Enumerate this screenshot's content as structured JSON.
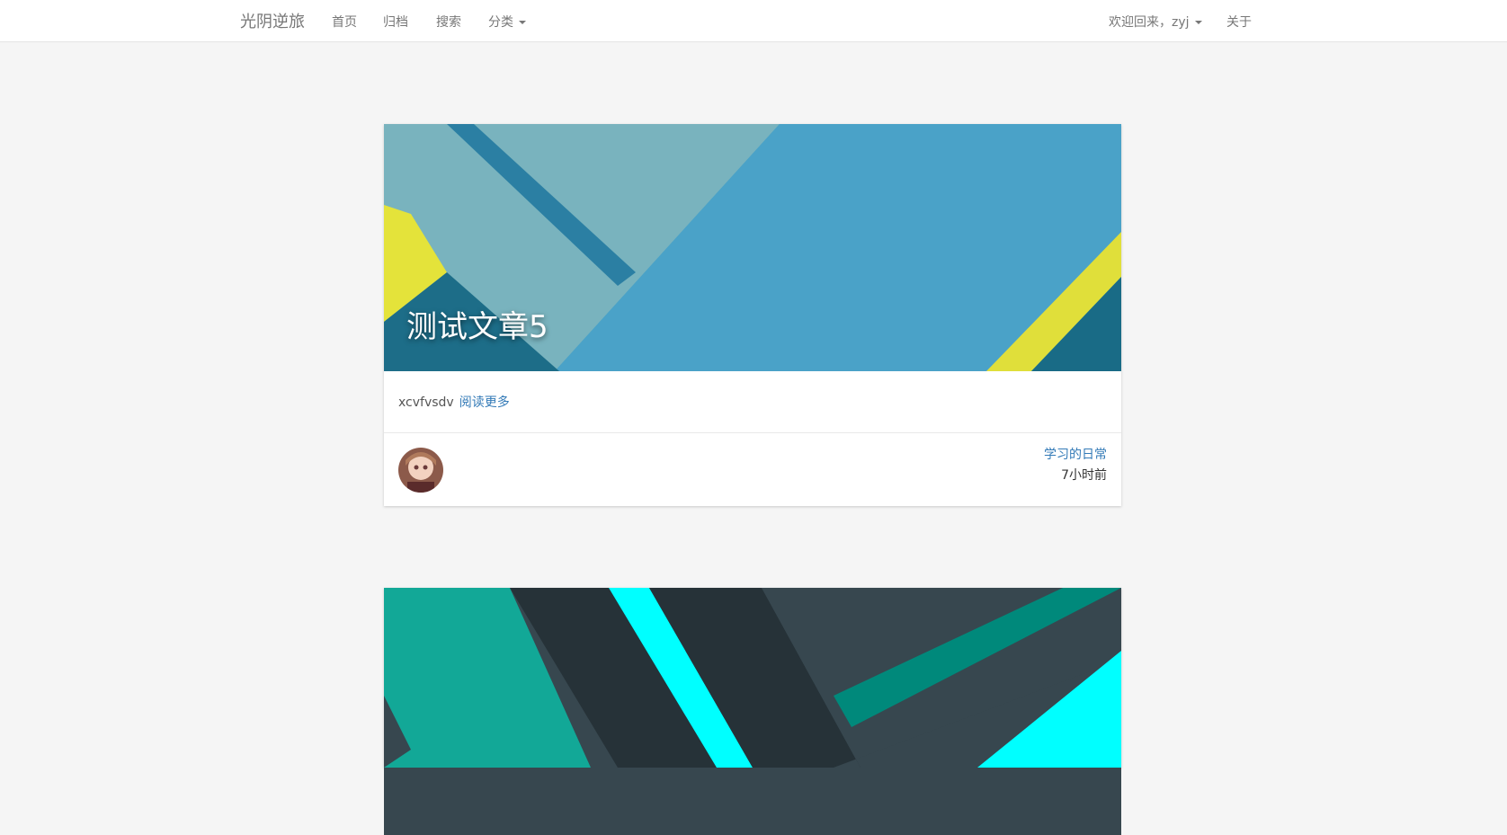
{
  "navbar": {
    "brand": "光阴逆旅",
    "links": {
      "home": "首页",
      "archive": "归档",
      "search": "搜索",
      "category": "分类"
    },
    "welcome": "欢迎回来，zyj",
    "about": "关于"
  },
  "posts": [
    {
      "title": "测试文章5",
      "excerpt": "xcvfvsdv",
      "read_more": "阅读更多",
      "category": "学习的日常",
      "time": "7小时前",
      "cover_colors": [
        "#3aa0c9",
        "#7ab4bf",
        "#2b7fa3",
        "#e6e53a",
        "#1a6f8c"
      ]
    },
    {
      "cover_colors": [
        "#13a89e",
        "#263238",
        "#00ffff",
        "#00897b",
        "#37474f"
      ]
    }
  ],
  "colors": {
    "accent": "#337ab7",
    "background": "#f5f5f5"
  }
}
